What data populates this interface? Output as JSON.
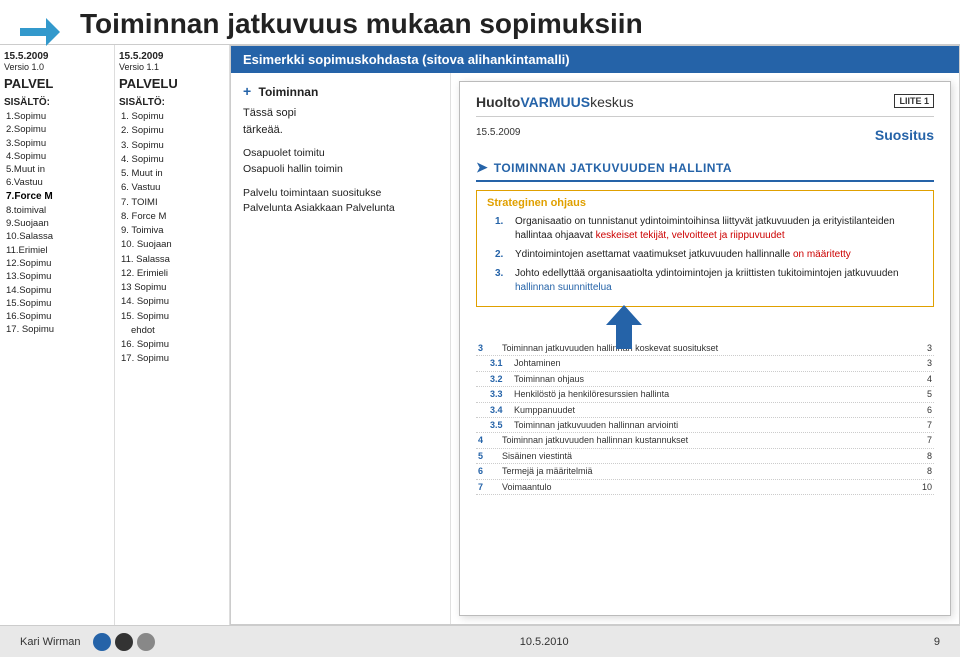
{
  "header": {
    "title": "Toiminnan jatkuvuus mukaan sopimuksiin",
    "arrow_label": "→"
  },
  "col1": {
    "date1": "15.5.2009",
    "version1": "Versio 1.0",
    "title": "PALVEL",
    "sisalto": "SISÄLTÖ:",
    "items": [
      "1.Sopimu",
      "2.Sopimu",
      "3.Sopimu",
      "4.Sopimu",
      "5.Muut in",
      "6.Vastuu",
      "7.Force M",
      "8.toimival",
      "9.Suojaan",
      "10.Salassa",
      "11.Erimiel",
      "12.Sopimu",
      "13.Sopimu",
      "14.Sopimu",
      "15.Sopimu",
      "16.Sopimu",
      "17. Sopimu"
    ],
    "highlight_item": "7.Force M"
  },
  "col2": {
    "date1": "15.5.2009",
    "version1": "Versio 1.1",
    "title": "PALVELU",
    "sisalto": "SISÄLTÖ:",
    "items": [
      "1. Sopimu",
      "2. Sopimu",
      "3. Sopimu",
      "4. Sopimu",
      "5. Muut in",
      "6. Vastuu",
      "7. TOIMI",
      "8. Force M",
      "9. Toimiva",
      "10. Suojaan",
      "11. Salassa",
      "12. Erimieli",
      "13 Sopimu",
      "14. Sopimu",
      "15. Sopimu",
      "   ehdot",
      "16. Sopimu",
      "17. Sopimu"
    ],
    "highlight_item": "7. TOIMI"
  },
  "main": {
    "example_title": "Esimerkki sopimuskohdasta (sitova alihankintamalli)",
    "doc_title": "Toiminnan",
    "tassa_sopi_text": "Tässä sopi",
    "tarkea_text": "tärkeää.",
    "osapuolet_text": "Osapuolet toimitu",
    "osapuoli2": "Osapuoli hallin toimin",
    "palvelu1": "Palvelu toimintaan suositukse",
    "palvelu2": "Palvelunta Asiakkaan Palvelunta",
    "plus_icon": "+",
    "suositus": "Suositus"
  },
  "document": {
    "logo_huolto": "Huolto",
    "logo_varmuus": "VARMUUS",
    "logo_keskus": "keskus",
    "liite": "LIITE 1",
    "date": "15.5.2009",
    "section_title": "TOIMINNAN JATKUVUUDEN HALLINTA",
    "strateginen_title": "Strateginen ohjaus",
    "strat_items": [
      {
        "num": "1.",
        "text_normal": "Organisaatio on tunnistanut ydintoimintoihinsa liittyvät jatkuvuuden ja erityistilanteiden hallintaa ohjaavat ",
        "text_highlight": "keskeiset tekijät, velvoitteet ja riippuvuudet",
        "text_after": ""
      },
      {
        "num": "2.",
        "text_normal": "Ydintoimintojen asettamat vaatimukset jatkuvuuden hallinnalle ",
        "text_highlight": "on määritetty",
        "text_after": ""
      },
      {
        "num": "3.",
        "text_normal": "Johto edellyttää organisaatiolta ydintoimintojen ja kriittisten tukitoimintojen jatkuvuuden ",
        "text_blue": "hallinnan suunnittelua",
        "text_after": ""
      }
    ],
    "toc": [
      {
        "num": "3",
        "label": "Toiminnan jatkuvuuden hallinnan koskevat suositukset",
        "page": "3"
      },
      {
        "num": "3.1",
        "label": "Johtaminen",
        "page": "3"
      },
      {
        "num": "3.2",
        "label": "Toiminnan ohjaus",
        "page": "4"
      },
      {
        "num": "3.3",
        "label": "Henkilöstö ja henkilöresurssien hallinta",
        "page": "5"
      },
      {
        "num": "3.4",
        "label": "Kumppanuudet",
        "page": "6"
      },
      {
        "num": "3.5",
        "label": "Toiminnan jatkuvuuden hallinnan arviointi",
        "page": "7"
      },
      {
        "num": "4",
        "label": "Toiminnan jatkuvuuden hallinnan kustannukset",
        "page": "7"
      },
      {
        "num": "5",
        "label": "Sisäinen viestintä",
        "page": "8"
      },
      {
        "num": "6",
        "label": "Termejä ja määritelmiä",
        "page": "8"
      },
      {
        "num": "7",
        "label": "Voimaantulo",
        "page": "10"
      }
    ]
  },
  "footer": {
    "author": "Kari Wirman",
    "date": "10.5.2010",
    "page": "9"
  }
}
